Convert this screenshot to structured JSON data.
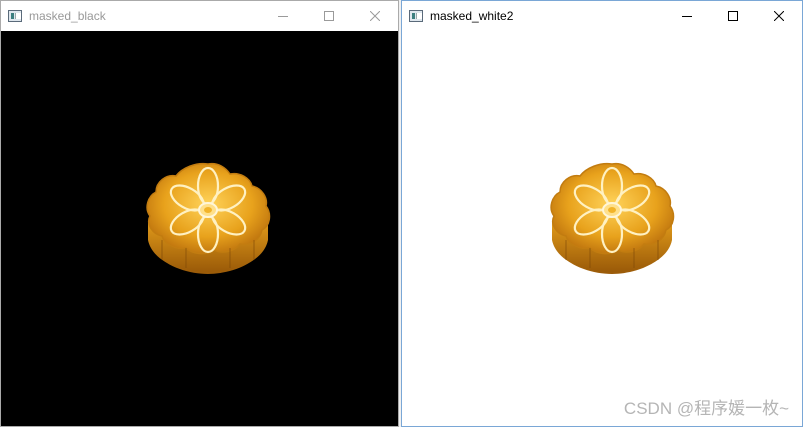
{
  "windows": [
    {
      "title": "masked_black",
      "state": "inactive",
      "background": "#000000",
      "content": "mooncake-image"
    },
    {
      "title": "masked_white2",
      "state": "active",
      "background": "#ffffff",
      "content": "mooncake-image"
    }
  ],
  "caption_buttons": [
    "minimize-icon",
    "maximize-icon",
    "close-icon"
  ],
  "watermark": "CSDN @程序媛一枚~",
  "colors": {
    "mooncake_gold": "#e8a21c",
    "mooncake_dark": "#b86d0c",
    "mooncake_highlight": "#fff1c2"
  }
}
